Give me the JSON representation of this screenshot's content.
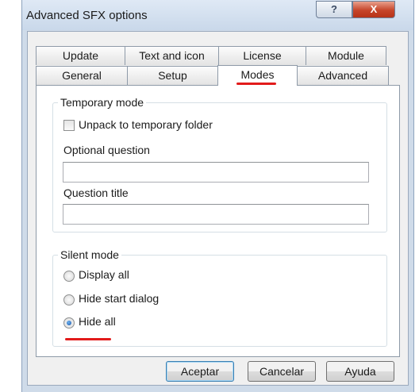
{
  "window": {
    "title": "Advanced SFX options",
    "help_label": "?",
    "close_label": "X"
  },
  "tabs": {
    "row1": [
      "Update",
      "Text and icon",
      "License",
      "Module"
    ],
    "row2": [
      "General",
      "Setup",
      "Modes",
      "Advanced"
    ],
    "active": "Modes"
  },
  "temporary_mode": {
    "title": "Temporary mode",
    "unpack_label": "Unpack to temporary folder",
    "unpack_checked": false,
    "optional_question_label": "Optional question",
    "optional_question_value": "",
    "question_title_label": "Question title",
    "question_title_value": ""
  },
  "silent_mode": {
    "title": "Silent mode",
    "options": [
      "Display all",
      "Hide start dialog",
      "Hide all"
    ],
    "selected": "Hide all"
  },
  "buttons": {
    "ok": "Aceptar",
    "cancel": "Cancelar",
    "help": "Ayuda"
  },
  "colors": {
    "annotation_red": "#e21b1b",
    "window_frame": "#cfdbe9",
    "radio_selected": "#1a56a8"
  }
}
